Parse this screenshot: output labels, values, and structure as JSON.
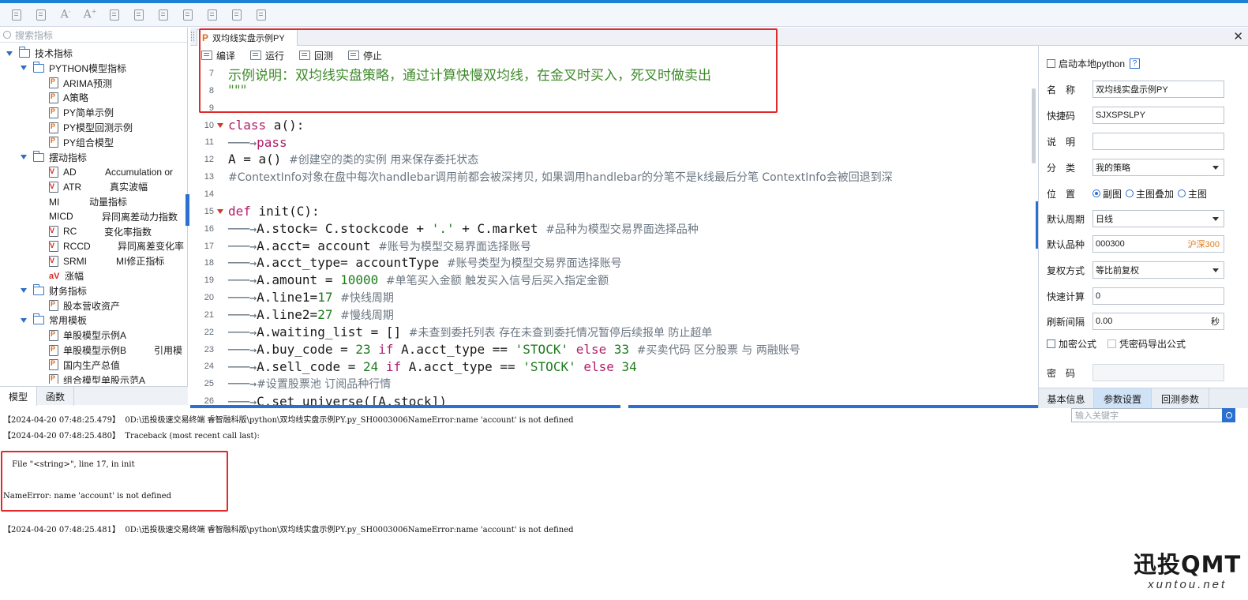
{
  "search": {
    "placeholder": "搜索指标"
  },
  "tree": [
    {
      "label": "技术指标",
      "type": "folder"
    },
    {
      "label": "PYTHON模型指标",
      "type": "folder"
    },
    {
      "label": "ARIMA预测",
      "type": "py"
    },
    {
      "label": "A策略",
      "type": "py"
    },
    {
      "label": "PY简单示例",
      "type": "py"
    },
    {
      "label": "PY模型回测示例",
      "type": "py"
    },
    {
      "label": "PY组合模型",
      "type": "py"
    },
    {
      "label": "摆动指标",
      "type": "folder"
    },
    {
      "label": "AD",
      "desc": "Accumulation or",
      "type": "v"
    },
    {
      "label": "ATR",
      "desc": "真实波幅",
      "type": "v"
    },
    {
      "label": "MI",
      "desc": "动量指标",
      "type": "none"
    },
    {
      "label": "MICD",
      "desc": "异同离差动力指数",
      "type": "none"
    },
    {
      "label": "RC",
      "desc": "变化率指数",
      "type": "v"
    },
    {
      "label": "RCCD",
      "desc": "异同离差变化率",
      "type": "v"
    },
    {
      "label": "SRMI",
      "desc": "MI修正指标",
      "type": "v"
    },
    {
      "label": "涨幅",
      "type": "av"
    },
    {
      "label": "财务指标",
      "type": "folder"
    },
    {
      "label": "股本营收资产",
      "type": "py"
    },
    {
      "label": "常用模板",
      "type": "folder"
    },
    {
      "label": "单股模型示例A",
      "type": "py"
    },
    {
      "label": "单股模型示例B",
      "desc": "引用模",
      "type": "py"
    },
    {
      "label": "国内生产总值",
      "type": "py"
    },
    {
      "label": "组合模型单股示范A",
      "type": "py"
    }
  ],
  "left_tabs": [
    "模型",
    "函数"
  ],
  "editor": {
    "tab_title": "双均线实盘示例PY",
    "close": "✕",
    "tools": [
      "编译",
      "运行",
      "回测",
      "停止"
    ]
  },
  "code_lines": [
    {
      "n": "7",
      "parts": [
        [
          "doc",
          "示例说明：双均线实盘策略，通过计算快慢双均线，在金叉时买入，死叉时做卖出"
        ]
      ]
    },
    {
      "n": "8",
      "parts": [
        [
          "doc",
          "\"\"\""
        ]
      ]
    },
    {
      "n": "9",
      "parts": []
    },
    {
      "n": "10",
      "fold": true,
      "parts": [
        [
          "kw",
          "class"
        ],
        [
          "pl",
          " a():"
        ]
      ]
    },
    {
      "n": "11",
      "indent": true,
      "parts": [
        [
          "kw",
          "pass"
        ]
      ]
    },
    {
      "n": "12",
      "parts": [
        [
          "pl",
          "A = a() "
        ],
        [
          "cm",
          "#创建空的类的实例 用来保存委托状态"
        ]
      ]
    },
    {
      "n": "13",
      "parts": [
        [
          "cm",
          "#ContextInfo对象在盘中每次handlebar调用前都会被深拷贝, 如果调用handlebar的分笔不是k线最后分笔 ContextInfo会被回退到深"
        ]
      ]
    },
    {
      "n": "14",
      "parts": []
    },
    {
      "n": "15",
      "fold": true,
      "parts": [
        [
          "kw",
          "def"
        ],
        [
          "pl",
          " init(C):"
        ]
      ]
    },
    {
      "n": "16",
      "indent": true,
      "parts": [
        [
          "pl",
          "A.stock= C.stockcode + "
        ],
        [
          "st",
          "'.'"
        ],
        [
          "pl",
          " + C.market "
        ],
        [
          "cm",
          "#品种为模型交易界面选择品种"
        ]
      ]
    },
    {
      "n": "17",
      "indent": true,
      "parts": [
        [
          "pl",
          "A.acct= account "
        ],
        [
          "cm",
          "#账号为模型交易界面选择账号"
        ]
      ]
    },
    {
      "n": "18",
      "indent": true,
      "parts": [
        [
          "pl",
          "A.acct_type= accountType "
        ],
        [
          "cm",
          "#账号类型为模型交易界面选择账号"
        ]
      ]
    },
    {
      "n": "19",
      "indent": true,
      "parts": [
        [
          "pl",
          "A.amount = "
        ],
        [
          "nm",
          "10000"
        ],
        [
          "pl",
          " "
        ],
        [
          "cm",
          "#单笔买入金额 触发买入信号后买入指定金额"
        ]
      ]
    },
    {
      "n": "20",
      "indent": true,
      "parts": [
        [
          "pl",
          "A.line1="
        ],
        [
          "nm",
          "17"
        ],
        [
          "pl",
          "   "
        ],
        [
          "cm",
          "#快线周期"
        ]
      ]
    },
    {
      "n": "21",
      "indent": true,
      "parts": [
        [
          "pl",
          "A.line2="
        ],
        [
          "nm",
          "27"
        ],
        [
          "pl",
          "   "
        ],
        [
          "cm",
          "#慢线周期"
        ]
      ]
    },
    {
      "n": "22",
      "indent": true,
      "parts": [
        [
          "pl",
          "A.waiting_list = [] "
        ],
        [
          "cm",
          "#未查到委托列表 存在未查到委托情况暂停后续报单 防止超单"
        ]
      ]
    },
    {
      "n": "23",
      "indent": true,
      "parts": [
        [
          "pl",
          "A.buy_code = "
        ],
        [
          "nm",
          "23"
        ],
        [
          "kw",
          " if "
        ],
        [
          "pl",
          "A.acct_type == "
        ],
        [
          "st",
          "'STOCK'"
        ],
        [
          "kw",
          " else "
        ],
        [
          "nm",
          "33"
        ],
        [
          "pl",
          " "
        ],
        [
          "cm",
          "#买卖代码 区分股票 与 两融账号"
        ]
      ]
    },
    {
      "n": "24",
      "indent": true,
      "parts": [
        [
          "pl",
          "A.sell_code = "
        ],
        [
          "nm",
          "24"
        ],
        [
          "kw",
          " if "
        ],
        [
          "pl",
          "A.acct_type == "
        ],
        [
          "st",
          "'STOCK'"
        ],
        [
          "kw",
          " else "
        ],
        [
          "nm",
          "34"
        ]
      ]
    },
    {
      "n": "25",
      "indent": true,
      "parts": [
        [
          "cm",
          "#设置股票池 订阅品种行情"
        ]
      ]
    },
    {
      "n": "26",
      "indent": true,
      "parts": [
        [
          "pl",
          "C.set_universe([A.stock])"
        ]
      ]
    }
  ],
  "props": {
    "start_local_python": "启动本地python",
    "help": "?",
    "name_label": "名　称",
    "name_value": "双均线实盘示例PY",
    "shortcut_label": "快捷码",
    "shortcut_value": "SJXSPSLPY",
    "desc_label": "说　明",
    "desc_value": "",
    "category_label": "分　类",
    "category_value": "我的策略",
    "position_label": "位　置",
    "position_options": [
      "副图",
      "主图叠加",
      "主图"
    ],
    "period_label": "默认周期",
    "period_value": "日线",
    "symbol_label": "默认品种",
    "symbol_value": "000300",
    "symbol_name": "沪深300",
    "adjust_label": "复权方式",
    "adjust_value": "等比前复权",
    "quick_label": "快速计算",
    "quick_value": "0",
    "refresh_label": "刷新间隔",
    "refresh_value": "0.00",
    "refresh_unit": "秒",
    "encrypt_label": "加密公式",
    "export_label": "凭密码导出公式",
    "password_label": "密　码",
    "password_value": "",
    "tabs": [
      "基本信息",
      "参数设置",
      "回测参数"
    ]
  },
  "output": {
    "filter_placeholder": "输入关键字",
    "lines": [
      "【2024-04-20 07:48:25.479】  0D:\\迅投极速交易终端 睿智融科版\\python\\双均线实盘示例PY.py_SH0003006NameError:name 'account' is not defined",
      "【2024-04-20 07:48:25.480】  Traceback (most recent call last):",
      " File \"<string>\", line 17, in init",
      "NameError: name 'account' is not defined",
      "【2024-04-20 07:48:25.481】  0D:\\迅投极速交易终端 睿智融科版\\python\\双均线实盘示例PY.py_SH0003006NameError:name 'account' is not defined"
    ]
  },
  "watermark": {
    "main": "迅投QMT",
    "sub": "xuntou.net"
  },
  "colors": {
    "accent": "#2b6fd0",
    "highlight": "#e02a2a",
    "keyword": "#b01f6a",
    "string": "#1e7b1e",
    "comment": "#6b7682"
  }
}
